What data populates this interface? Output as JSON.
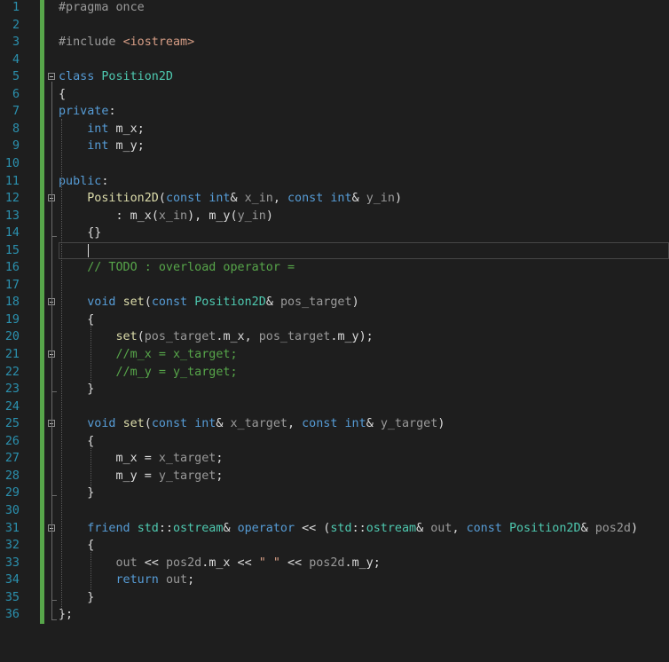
{
  "editor": {
    "colors": {
      "background": "#1e1e1e",
      "line_number": "#2b91af",
      "keyword": "#569cd6",
      "type": "#4ec9b0",
      "function": "#dcdcaa",
      "member": "#dadada",
      "param": "#9a9a9a",
      "comment": "#57a64a",
      "string": "#d69d85",
      "preprocessor": "#9b9b9b",
      "default": "#dcdcdc"
    },
    "lines": [
      {
        "n": "1",
        "fold": false,
        "tokens": [
          {
            "t": "#pragma once",
            "c": "preprocessor"
          }
        ]
      },
      {
        "n": "2",
        "fold": false,
        "tokens": []
      },
      {
        "n": "3",
        "fold": false,
        "tokens": [
          {
            "t": "#include ",
            "c": "preprocessor"
          },
          {
            "t": "<iostream>",
            "c": "string"
          }
        ]
      },
      {
        "n": "4",
        "fold": false,
        "tokens": []
      },
      {
        "n": "5",
        "fold": true,
        "tokens": [
          {
            "t": "class",
            "c": "keyword"
          },
          {
            "t": " ",
            "c": "default"
          },
          {
            "t": "Position2D",
            "c": "type"
          }
        ]
      },
      {
        "n": "6",
        "fold": false,
        "tokens": [
          {
            "t": "{",
            "c": "default"
          }
        ]
      },
      {
        "n": "7",
        "fold": false,
        "tokens": [
          {
            "t": "private",
            "c": "keyword"
          },
          {
            "t": ":",
            "c": "default"
          }
        ]
      },
      {
        "n": "8",
        "fold": false,
        "tokens": [
          {
            "t": "    ",
            "c": "default"
          },
          {
            "t": "int",
            "c": "keyword"
          },
          {
            "t": " ",
            "c": "default"
          },
          {
            "t": "m_x",
            "c": "member"
          },
          {
            "t": ";",
            "c": "default"
          }
        ]
      },
      {
        "n": "9",
        "fold": false,
        "tokens": [
          {
            "t": "    ",
            "c": "default"
          },
          {
            "t": "int",
            "c": "keyword"
          },
          {
            "t": " ",
            "c": "default"
          },
          {
            "t": "m_y",
            "c": "member"
          },
          {
            "t": ";",
            "c": "default"
          }
        ]
      },
      {
        "n": "10",
        "fold": false,
        "tokens": []
      },
      {
        "n": "11",
        "fold": false,
        "tokens": [
          {
            "t": "public",
            "c": "keyword"
          },
          {
            "t": ":",
            "c": "default"
          }
        ]
      },
      {
        "n": "12",
        "fold": true,
        "tokens": [
          {
            "t": "    ",
            "c": "default"
          },
          {
            "t": "Position2D",
            "c": "function"
          },
          {
            "t": "(",
            "c": "default"
          },
          {
            "t": "const",
            "c": "keyword"
          },
          {
            "t": " ",
            "c": "default"
          },
          {
            "t": "int",
            "c": "keyword"
          },
          {
            "t": "& ",
            "c": "default"
          },
          {
            "t": "x_in",
            "c": "param"
          },
          {
            "t": ", ",
            "c": "default"
          },
          {
            "t": "const",
            "c": "keyword"
          },
          {
            "t": " ",
            "c": "default"
          },
          {
            "t": "int",
            "c": "keyword"
          },
          {
            "t": "& ",
            "c": "default"
          },
          {
            "t": "y_in",
            "c": "param"
          },
          {
            "t": ")",
            "c": "default"
          }
        ]
      },
      {
        "n": "13",
        "fold": false,
        "tokens": [
          {
            "t": "        : ",
            "c": "default"
          },
          {
            "t": "m_x",
            "c": "member"
          },
          {
            "t": "(",
            "c": "default"
          },
          {
            "t": "x_in",
            "c": "param"
          },
          {
            "t": "), ",
            "c": "default"
          },
          {
            "t": "m_y",
            "c": "member"
          },
          {
            "t": "(",
            "c": "default"
          },
          {
            "t": "y_in",
            "c": "param"
          },
          {
            "t": ")",
            "c": "default"
          }
        ]
      },
      {
        "n": "14",
        "fold": false,
        "tokens": [
          {
            "t": "    {}",
            "c": "default"
          }
        ]
      },
      {
        "n": "15",
        "fold": false,
        "tokens": []
      },
      {
        "n": "16",
        "fold": false,
        "tokens": [
          {
            "t": "    ",
            "c": "default"
          },
          {
            "t": "// TODO : overload operator =",
            "c": "comment"
          }
        ]
      },
      {
        "n": "17",
        "fold": false,
        "tokens": []
      },
      {
        "n": "18",
        "fold": true,
        "tokens": [
          {
            "t": "    ",
            "c": "default"
          },
          {
            "t": "void",
            "c": "keyword"
          },
          {
            "t": " ",
            "c": "default"
          },
          {
            "t": "set",
            "c": "function"
          },
          {
            "t": "(",
            "c": "default"
          },
          {
            "t": "const",
            "c": "keyword"
          },
          {
            "t": " ",
            "c": "default"
          },
          {
            "t": "Position2D",
            "c": "type"
          },
          {
            "t": "& ",
            "c": "default"
          },
          {
            "t": "pos_target",
            "c": "param"
          },
          {
            "t": ")",
            "c": "default"
          }
        ]
      },
      {
        "n": "19",
        "fold": false,
        "tokens": [
          {
            "t": "    {",
            "c": "default"
          }
        ]
      },
      {
        "n": "20",
        "fold": false,
        "tokens": [
          {
            "t": "        ",
            "c": "default"
          },
          {
            "t": "set",
            "c": "function"
          },
          {
            "t": "(",
            "c": "default"
          },
          {
            "t": "pos_target",
            "c": "param"
          },
          {
            "t": ".",
            "c": "default"
          },
          {
            "t": "m_x",
            "c": "member"
          },
          {
            "t": ", ",
            "c": "default"
          },
          {
            "t": "pos_target",
            "c": "param"
          },
          {
            "t": ".",
            "c": "default"
          },
          {
            "t": "m_y",
            "c": "member"
          },
          {
            "t": ");",
            "c": "default"
          }
        ]
      },
      {
        "n": "21",
        "fold": true,
        "tokens": [
          {
            "t": "        ",
            "c": "default"
          },
          {
            "t": "//m_x = x_target;",
            "c": "comment"
          }
        ]
      },
      {
        "n": "22",
        "fold": false,
        "tokens": [
          {
            "t": "        ",
            "c": "default"
          },
          {
            "t": "//m_y = y_target;",
            "c": "comment"
          }
        ]
      },
      {
        "n": "23",
        "fold": false,
        "tokens": [
          {
            "t": "    }",
            "c": "default"
          }
        ]
      },
      {
        "n": "24",
        "fold": false,
        "tokens": []
      },
      {
        "n": "25",
        "fold": true,
        "tokens": [
          {
            "t": "    ",
            "c": "default"
          },
          {
            "t": "void",
            "c": "keyword"
          },
          {
            "t": " ",
            "c": "default"
          },
          {
            "t": "set",
            "c": "function"
          },
          {
            "t": "(",
            "c": "default"
          },
          {
            "t": "const",
            "c": "keyword"
          },
          {
            "t": " ",
            "c": "default"
          },
          {
            "t": "int",
            "c": "keyword"
          },
          {
            "t": "& ",
            "c": "default"
          },
          {
            "t": "x_target",
            "c": "param"
          },
          {
            "t": ", ",
            "c": "default"
          },
          {
            "t": "const",
            "c": "keyword"
          },
          {
            "t": " ",
            "c": "default"
          },
          {
            "t": "int",
            "c": "keyword"
          },
          {
            "t": "& ",
            "c": "default"
          },
          {
            "t": "y_target",
            "c": "param"
          },
          {
            "t": ")",
            "c": "default"
          }
        ]
      },
      {
        "n": "26",
        "fold": false,
        "tokens": [
          {
            "t": "    {",
            "c": "default"
          }
        ]
      },
      {
        "n": "27",
        "fold": false,
        "tokens": [
          {
            "t": "        ",
            "c": "default"
          },
          {
            "t": "m_x",
            "c": "member"
          },
          {
            "t": " = ",
            "c": "default"
          },
          {
            "t": "x_target",
            "c": "param"
          },
          {
            "t": ";",
            "c": "default"
          }
        ]
      },
      {
        "n": "28",
        "fold": false,
        "tokens": [
          {
            "t": "        ",
            "c": "default"
          },
          {
            "t": "m_y",
            "c": "member"
          },
          {
            "t": " = ",
            "c": "default"
          },
          {
            "t": "y_target",
            "c": "param"
          },
          {
            "t": ";",
            "c": "default"
          }
        ]
      },
      {
        "n": "29",
        "fold": false,
        "tokens": [
          {
            "t": "    }",
            "c": "default"
          }
        ]
      },
      {
        "n": "30",
        "fold": false,
        "tokens": []
      },
      {
        "n": "31",
        "fold": true,
        "tokens": [
          {
            "t": "    ",
            "c": "default"
          },
          {
            "t": "friend",
            "c": "keyword"
          },
          {
            "t": " ",
            "c": "default"
          },
          {
            "t": "std",
            "c": "type"
          },
          {
            "t": "::",
            "c": "default"
          },
          {
            "t": "ostream",
            "c": "type"
          },
          {
            "t": "& ",
            "c": "default"
          },
          {
            "t": "operator",
            "c": "keyword"
          },
          {
            "t": " << (",
            "c": "default"
          },
          {
            "t": "std",
            "c": "type"
          },
          {
            "t": "::",
            "c": "default"
          },
          {
            "t": "ostream",
            "c": "type"
          },
          {
            "t": "& ",
            "c": "default"
          },
          {
            "t": "out",
            "c": "param"
          },
          {
            "t": ", ",
            "c": "default"
          },
          {
            "t": "const",
            "c": "keyword"
          },
          {
            "t": " ",
            "c": "default"
          },
          {
            "t": "Position2D",
            "c": "type"
          },
          {
            "t": "& ",
            "c": "default"
          },
          {
            "t": "pos2d",
            "c": "param"
          },
          {
            "t": ")",
            "c": "default"
          }
        ]
      },
      {
        "n": "32",
        "fold": false,
        "tokens": [
          {
            "t": "    {",
            "c": "default"
          }
        ]
      },
      {
        "n": "33",
        "fold": false,
        "tokens": [
          {
            "t": "        ",
            "c": "default"
          },
          {
            "t": "out",
            "c": "param"
          },
          {
            "t": " << ",
            "c": "default"
          },
          {
            "t": "pos2d",
            "c": "param"
          },
          {
            "t": ".",
            "c": "default"
          },
          {
            "t": "m_x",
            "c": "member"
          },
          {
            "t": " << ",
            "c": "default"
          },
          {
            "t": "\" \"",
            "c": "string"
          },
          {
            "t": " << ",
            "c": "default"
          },
          {
            "t": "pos2d",
            "c": "param"
          },
          {
            "t": ".",
            "c": "default"
          },
          {
            "t": "m_y",
            "c": "member"
          },
          {
            "t": ";",
            "c": "default"
          }
        ]
      },
      {
        "n": "34",
        "fold": false,
        "tokens": [
          {
            "t": "        ",
            "c": "default"
          },
          {
            "t": "return",
            "c": "keyword"
          },
          {
            "t": " ",
            "c": "default"
          },
          {
            "t": "out",
            "c": "param"
          },
          {
            "t": ";",
            "c": "default"
          }
        ]
      },
      {
        "n": "35",
        "fold": false,
        "tokens": [
          {
            "t": "    }",
            "c": "default"
          }
        ]
      },
      {
        "n": "36",
        "fold": false,
        "tokens": [
          {
            "t": "};",
            "c": "default"
          }
        ]
      }
    ]
  }
}
